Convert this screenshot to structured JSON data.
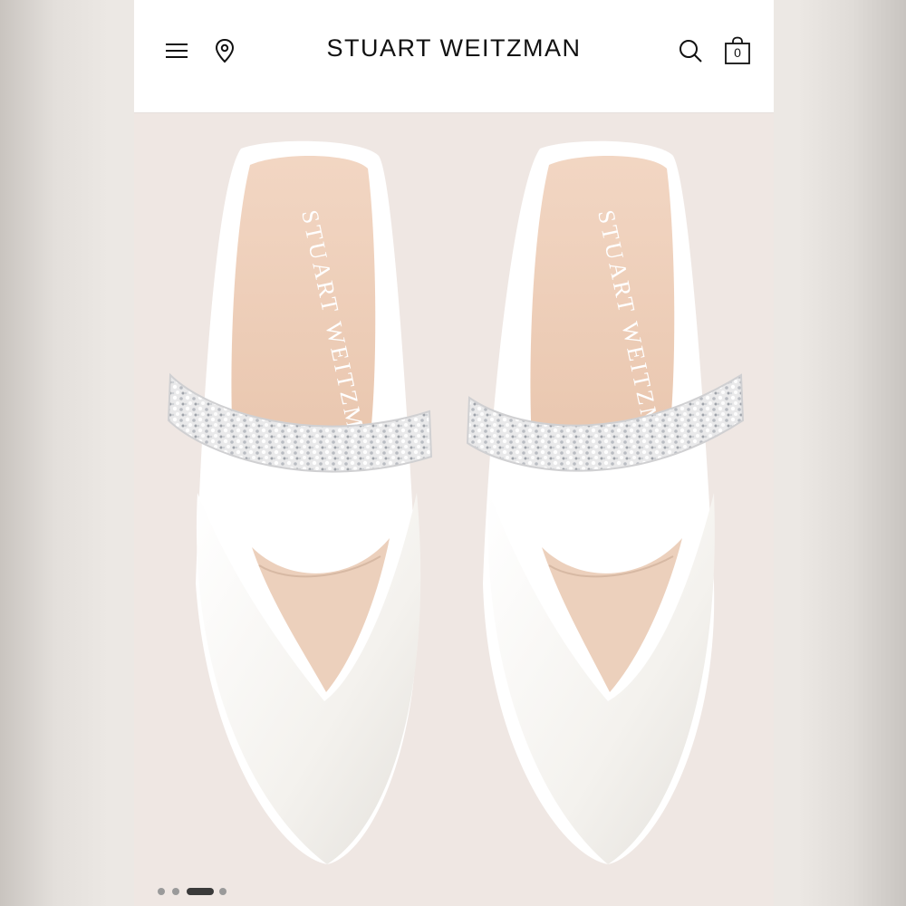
{
  "header": {
    "brand": "STUART WEITZMAN",
    "menu_icon": "hamburger-menu-icon",
    "location_icon": "map-pin-icon",
    "search_icon": "search-icon",
    "bag_icon": "shopping-bag-icon",
    "bag_count": "0"
  },
  "product_image": {
    "insole_logo": "STUART WEITZMAN",
    "background_color": "#efe7e3",
    "shoe_color": "#f6f4f0"
  },
  "carousel": {
    "total_slides": 4,
    "active_slide": 3
  }
}
